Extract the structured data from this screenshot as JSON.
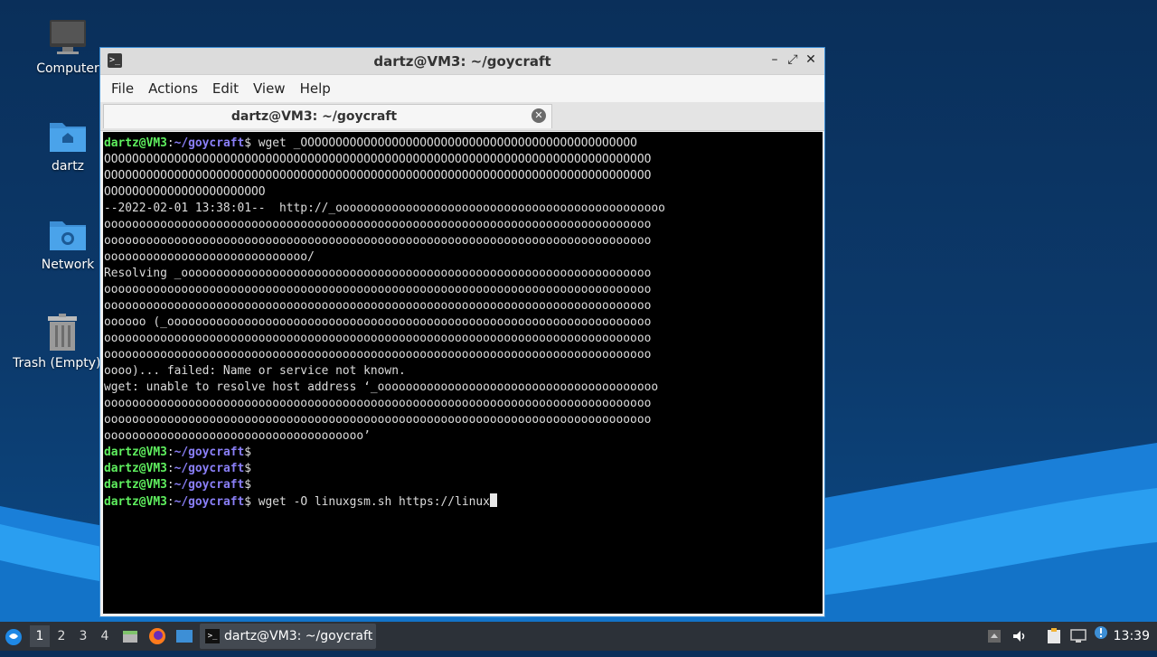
{
  "desktop": {
    "icons": [
      {
        "label": "Computer"
      },
      {
        "label": "dartz"
      },
      {
        "label": "Network"
      },
      {
        "label": "Trash (Empty)"
      }
    ]
  },
  "window": {
    "title": "dartz@VM3: ~/goycraft",
    "menu": [
      "File",
      "Actions",
      "Edit",
      "View",
      "Help"
    ],
    "tab_label": "dartz@VM3: ~/goycraft",
    "controls": {
      "minimize": "–",
      "maximize": "⤢",
      "close": "✕"
    }
  },
  "terminal": {
    "prompt_user": "dartz@VM3",
    "prompt_path": "~/goycraft",
    "lines": [
      {
        "prompt": true,
        "text": " wget _OOOOOOOOOOOOOOOOOOOOOOOOOOOOOOOOOOOOOOOOOOOOOOOO"
      },
      {
        "prompt": false,
        "text": "OOOOOOOOOOOOOOOOOOOOOOOOOOOOOOOOOOOOOOOOOOOOOOOOOOOOOOOOOOOOOOOOOOOOOOOOOOOOOO"
      },
      {
        "prompt": false,
        "text": "OOOOOOOOOOOOOOOOOOOOOOOOOOOOOOOOOOOOOOOOOOOOOOOOOOOOOOOOOOOOOOOOOOOOOOOOOOOOOO"
      },
      {
        "prompt": false,
        "text": "OOOOOOOOOOOOOOOOOOOOOOO"
      },
      {
        "prompt": false,
        "text": "--2022-02-01 13:38:01--  http://_ooooooooooooooooooooooooooooooooooooooooooooooo"
      },
      {
        "prompt": false,
        "text": "oooooooooooooooooooooooooooooooooooooooooooooooooooooooooooooooooooooooooooooo"
      },
      {
        "prompt": false,
        "text": "oooooooooooooooooooooooooooooooooooooooooooooooooooooooooooooooooooooooooooooo"
      },
      {
        "prompt": false,
        "text": "ooooooooooooooooooooooooooooo/"
      },
      {
        "prompt": false,
        "text": "Resolving _ooooooooooooooooooooooooooooooooooooooooooooooooooooooooooooooooooo"
      },
      {
        "prompt": false,
        "text": "oooooooooooooooooooooooooooooooooooooooooooooooooooooooooooooooooooooooooooooo"
      },
      {
        "prompt": false,
        "text": "oooooooooooooooooooooooooooooooooooooooooooooooooooooooooooooooooooooooooooooo"
      },
      {
        "prompt": false,
        "text": "oooooo (_ooooooooooooooooooooooooooooooooooooooooooooooooooooooooooooooooooooo"
      },
      {
        "prompt": false,
        "text": "oooooooooooooooooooooooooooooooooooooooooooooooooooooooooooooooooooooooooooooo"
      },
      {
        "prompt": false,
        "text": "oooooooooooooooooooooooooooooooooooooooooooooooooooooooooooooooooooooooooooooo"
      },
      {
        "prompt": false,
        "text": "oooo)... failed: Name or service not known."
      },
      {
        "prompt": false,
        "text": "wget: unable to resolve host address ‘_oooooooooooooooooooooooooooooooooooooooo"
      },
      {
        "prompt": false,
        "text": "oooooooooooooooooooooooooooooooooooooooooooooooooooooooooooooooooooooooooooooo"
      },
      {
        "prompt": false,
        "text": "oooooooooooooooooooooooooooooooooooooooooooooooooooooooooooooooooooooooooooooo"
      },
      {
        "prompt": false,
        "text": "ooooooooooooooooooooooooooooooooooooo’"
      },
      {
        "prompt": true,
        "text": ""
      },
      {
        "prompt": true,
        "text": ""
      },
      {
        "prompt": true,
        "text": ""
      },
      {
        "prompt": true,
        "text": " wget -O linuxgsm.sh https://linux",
        "cursor": true
      }
    ]
  },
  "taskbar": {
    "workspaces": [
      "1",
      "2",
      "3",
      "4"
    ],
    "active_workspace": "1",
    "task_label": "dartz@VM3: ~/goycraft",
    "clock": "13:39"
  }
}
